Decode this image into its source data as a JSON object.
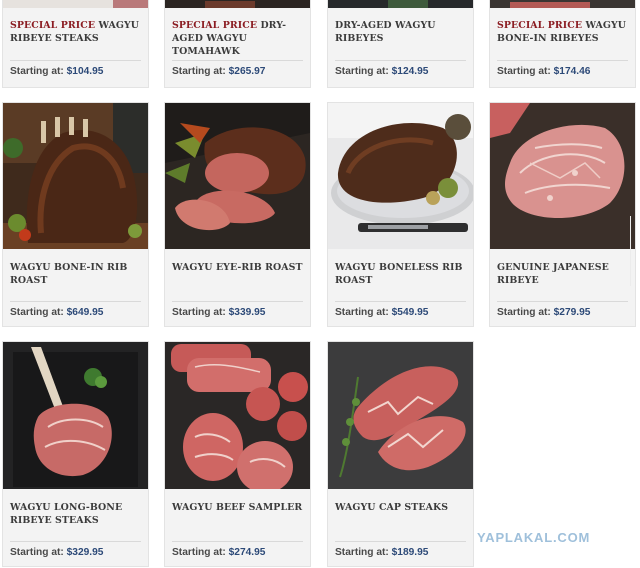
{
  "starting_label": "Starting at:",
  "row1": [
    {
      "special": "SPECIAL PRICE",
      "name": "WAGYU RIBEYE STEAKS",
      "price": "$104.95"
    },
    {
      "special": "SPECIAL PRICE",
      "name": "DRY-AGED WAGYU TOMAHAWK",
      "price": "$265.97"
    },
    {
      "special": "",
      "name": "DRY-AGED WAGYU RIBEYES",
      "price": "$124.95"
    },
    {
      "special": "SPECIAL PRICE",
      "name": "WAGYU BONE-IN RIBEYES",
      "price": "$174.46"
    }
  ],
  "row2": [
    {
      "name": "WAGYU BONE-IN RIB ROAST",
      "price": "$649.95"
    },
    {
      "name": "WAGYU EYE-RIB ROAST",
      "price": "$339.95"
    },
    {
      "name": "WAGYU BONELESS RIB ROAST",
      "price": "$549.95"
    },
    {
      "name": "GENUINE JAPANESE RIBEYE",
      "price": "$279.95"
    }
  ],
  "row3": [
    {
      "name": "WAGYU LONG-BONE RIBEYE STEAKS",
      "price": "$329.95"
    },
    {
      "name": "WAGYU BEEF SAMPLER",
      "price": "$274.95"
    },
    {
      "name": "WAGYU CAP STEAKS",
      "price": "$189.95"
    }
  ],
  "watermark": "YAPLAKAL.COM",
  "colors": {
    "special": "#8b1c22",
    "price": "#2d4a78",
    "card_bg": "#f3f3f3",
    "name": "#3b3b3b"
  }
}
